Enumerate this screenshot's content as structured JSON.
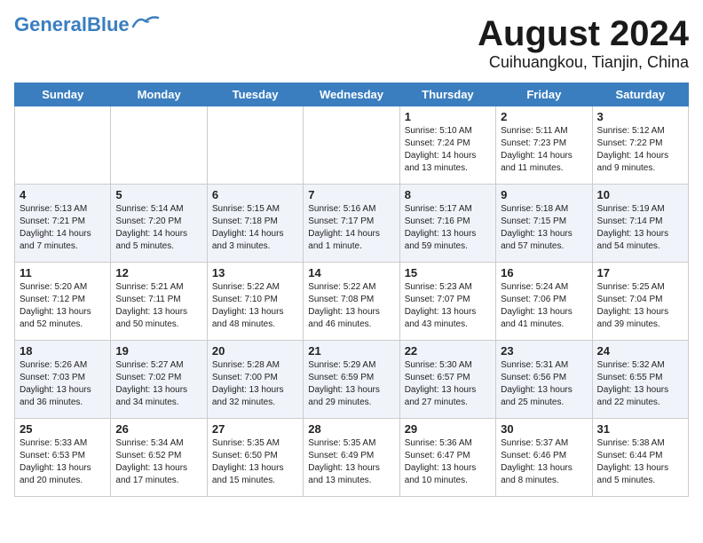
{
  "header": {
    "logo_general": "General",
    "logo_blue": "Blue",
    "month_title": "August 2024",
    "location": "Cuihuangkou, Tianjin, China"
  },
  "weekdays": [
    "Sunday",
    "Monday",
    "Tuesday",
    "Wednesday",
    "Thursday",
    "Friday",
    "Saturday"
  ],
  "weeks": [
    [
      {
        "day": "",
        "info": ""
      },
      {
        "day": "",
        "info": ""
      },
      {
        "day": "",
        "info": ""
      },
      {
        "day": "",
        "info": ""
      },
      {
        "day": "1",
        "info": "Sunrise: 5:10 AM\nSunset: 7:24 PM\nDaylight: 14 hours\nand 13 minutes."
      },
      {
        "day": "2",
        "info": "Sunrise: 5:11 AM\nSunset: 7:23 PM\nDaylight: 14 hours\nand 11 minutes."
      },
      {
        "day": "3",
        "info": "Sunrise: 5:12 AM\nSunset: 7:22 PM\nDaylight: 14 hours\nand 9 minutes."
      }
    ],
    [
      {
        "day": "4",
        "info": "Sunrise: 5:13 AM\nSunset: 7:21 PM\nDaylight: 14 hours\nand 7 minutes."
      },
      {
        "day": "5",
        "info": "Sunrise: 5:14 AM\nSunset: 7:20 PM\nDaylight: 14 hours\nand 5 minutes."
      },
      {
        "day": "6",
        "info": "Sunrise: 5:15 AM\nSunset: 7:18 PM\nDaylight: 14 hours\nand 3 minutes."
      },
      {
        "day": "7",
        "info": "Sunrise: 5:16 AM\nSunset: 7:17 PM\nDaylight: 14 hours\nand 1 minute."
      },
      {
        "day": "8",
        "info": "Sunrise: 5:17 AM\nSunset: 7:16 PM\nDaylight: 13 hours\nand 59 minutes."
      },
      {
        "day": "9",
        "info": "Sunrise: 5:18 AM\nSunset: 7:15 PM\nDaylight: 13 hours\nand 57 minutes."
      },
      {
        "day": "10",
        "info": "Sunrise: 5:19 AM\nSunset: 7:14 PM\nDaylight: 13 hours\nand 54 minutes."
      }
    ],
    [
      {
        "day": "11",
        "info": "Sunrise: 5:20 AM\nSunset: 7:12 PM\nDaylight: 13 hours\nand 52 minutes."
      },
      {
        "day": "12",
        "info": "Sunrise: 5:21 AM\nSunset: 7:11 PM\nDaylight: 13 hours\nand 50 minutes."
      },
      {
        "day": "13",
        "info": "Sunrise: 5:22 AM\nSunset: 7:10 PM\nDaylight: 13 hours\nand 48 minutes."
      },
      {
        "day": "14",
        "info": "Sunrise: 5:22 AM\nSunset: 7:08 PM\nDaylight: 13 hours\nand 46 minutes."
      },
      {
        "day": "15",
        "info": "Sunrise: 5:23 AM\nSunset: 7:07 PM\nDaylight: 13 hours\nand 43 minutes."
      },
      {
        "day": "16",
        "info": "Sunrise: 5:24 AM\nSunset: 7:06 PM\nDaylight: 13 hours\nand 41 minutes."
      },
      {
        "day": "17",
        "info": "Sunrise: 5:25 AM\nSunset: 7:04 PM\nDaylight: 13 hours\nand 39 minutes."
      }
    ],
    [
      {
        "day": "18",
        "info": "Sunrise: 5:26 AM\nSunset: 7:03 PM\nDaylight: 13 hours\nand 36 minutes."
      },
      {
        "day": "19",
        "info": "Sunrise: 5:27 AM\nSunset: 7:02 PM\nDaylight: 13 hours\nand 34 minutes."
      },
      {
        "day": "20",
        "info": "Sunrise: 5:28 AM\nSunset: 7:00 PM\nDaylight: 13 hours\nand 32 minutes."
      },
      {
        "day": "21",
        "info": "Sunrise: 5:29 AM\nSunset: 6:59 PM\nDaylight: 13 hours\nand 29 minutes."
      },
      {
        "day": "22",
        "info": "Sunrise: 5:30 AM\nSunset: 6:57 PM\nDaylight: 13 hours\nand 27 minutes."
      },
      {
        "day": "23",
        "info": "Sunrise: 5:31 AM\nSunset: 6:56 PM\nDaylight: 13 hours\nand 25 minutes."
      },
      {
        "day": "24",
        "info": "Sunrise: 5:32 AM\nSunset: 6:55 PM\nDaylight: 13 hours\nand 22 minutes."
      }
    ],
    [
      {
        "day": "25",
        "info": "Sunrise: 5:33 AM\nSunset: 6:53 PM\nDaylight: 13 hours\nand 20 minutes."
      },
      {
        "day": "26",
        "info": "Sunrise: 5:34 AM\nSunset: 6:52 PM\nDaylight: 13 hours\nand 17 minutes."
      },
      {
        "day": "27",
        "info": "Sunrise: 5:35 AM\nSunset: 6:50 PM\nDaylight: 13 hours\nand 15 minutes."
      },
      {
        "day": "28",
        "info": "Sunrise: 5:35 AM\nSunset: 6:49 PM\nDaylight: 13 hours\nand 13 minutes."
      },
      {
        "day": "29",
        "info": "Sunrise: 5:36 AM\nSunset: 6:47 PM\nDaylight: 13 hours\nand 10 minutes."
      },
      {
        "day": "30",
        "info": "Sunrise: 5:37 AM\nSunset: 6:46 PM\nDaylight: 13 hours\nand 8 minutes."
      },
      {
        "day": "31",
        "info": "Sunrise: 5:38 AM\nSunset: 6:44 PM\nDaylight: 13 hours\nand 5 minutes."
      }
    ]
  ]
}
